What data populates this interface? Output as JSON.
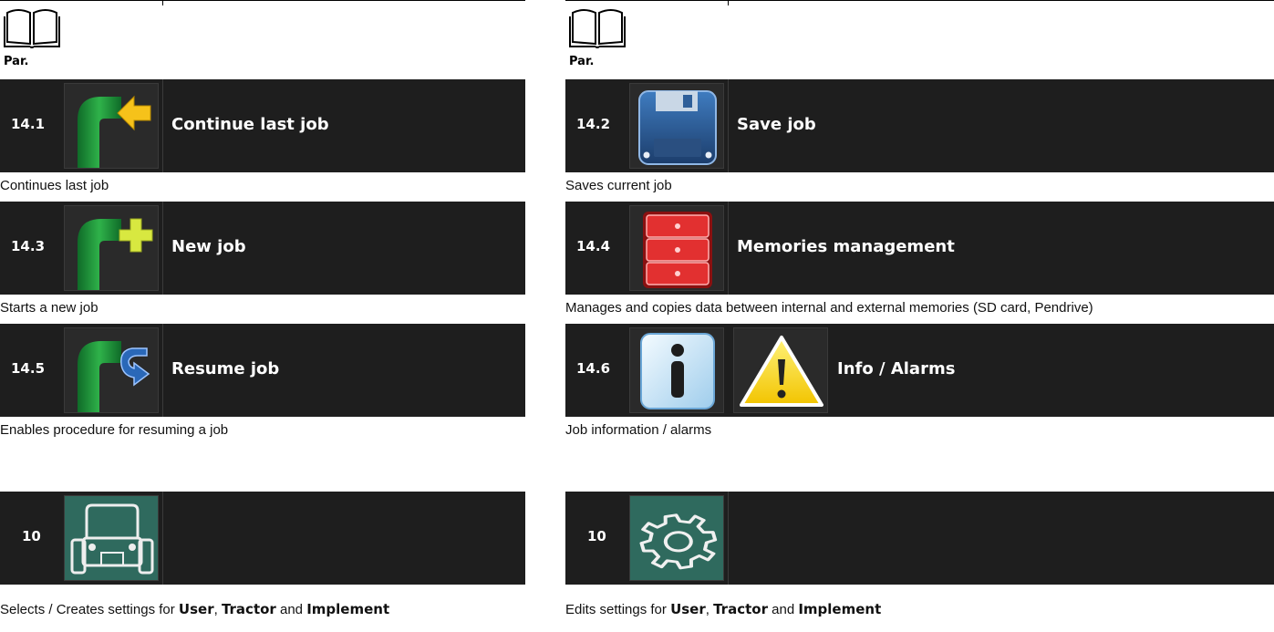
{
  "left": {
    "par_label": "Par.",
    "items": [
      {
        "par": "14.1",
        "title": "Continue last job",
        "description": "Continues last job",
        "icon": "continue-job-icon"
      },
      {
        "par": "14.3",
        "title": "New job",
        "description": "Starts a new job",
        "icon": "new-job-icon"
      },
      {
        "par": "14.5",
        "title": "Resume job",
        "description": "Enables procedure for resuming a job",
        "icon": "resume-job-icon"
      },
      {
        "par": "10",
        "title": "",
        "description_prefix": "Selects / Creates settings for ",
        "bold_1": "User",
        "sep_1": ", ",
        "bold_2": "Tractor",
        "sep_2": " and ",
        "bold_3": "Implement",
        "icon": "tractor-icon"
      }
    ]
  },
  "right": {
    "par_label": "Par.",
    "items": [
      {
        "par": "14.2",
        "title": "Save job",
        "description": "Saves current job",
        "icon": "floppy-disk-icon"
      },
      {
        "par": "14.4",
        "title": "Memories management",
        "description": "Manages and copies data between internal and external memories (SD card, Pendrive)",
        "icon": "memory-drawers-icon"
      },
      {
        "par": "14.6",
        "title": "Info / Alarms",
        "description": "Job information / alarms",
        "icon": "info-icon"
      },
      {
        "par": "10",
        "title": "",
        "description_prefix": "Edits settings for ",
        "bold_1": "User",
        "sep_1": ", ",
        "bold_2": "Tractor",
        "sep_2": " and ",
        "bold_3": "Implement",
        "icon": "gear-icon"
      }
    ]
  },
  "colors": {
    "row_background": "#1e1e1e",
    "icon_green": "#1f9a3a",
    "icon_yellow": "#f6c21a",
    "icon_blue": "#2a68b8",
    "icon_red": "#d42020"
  }
}
